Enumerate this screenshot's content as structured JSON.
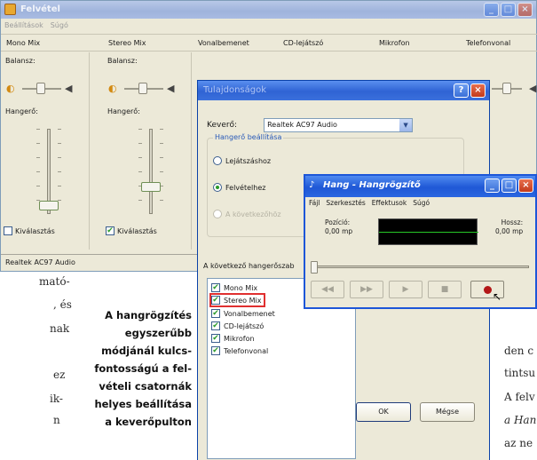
{
  "mixer": {
    "title": "Felvétel",
    "menu": [
      "Beállítások",
      "Súgó"
    ],
    "columns": [
      "Mono Mix",
      "Stereo Mix",
      "Vonalbemenet",
      "CD-lejátszó",
      "Mikrofon",
      "Telefonvonal"
    ],
    "balance_label": "Balansz:",
    "volume_label": "Hangerő:",
    "select_label": "Kiválasztás",
    "channels": [
      {
        "name": "Mono Mix",
        "selected": false,
        "volume_level": 0.06
      },
      {
        "name": "Stereo Mix",
        "selected": true,
        "volume_level": 0.3
      }
    ],
    "status": "Realtek AC97 Audio"
  },
  "properties": {
    "title": "Tulajdonságok",
    "mixer_label": "Keverő:",
    "mixer_value": "Realtek AC97 Audio",
    "group_label": "Hangerő beállítása",
    "options": [
      "Lejátszáshoz",
      "Felvételhez",
      "A következőhöz"
    ],
    "selected_option": "Felvételhez",
    "list_label": "A következő hangerőszab",
    "list_items": [
      "Mono Mix",
      "Stereo Mix",
      "Vonalbemenet",
      "CD-lejátszó",
      "Mikrofon",
      "Telefonvonal"
    ],
    "highlighted_item": "Stereo Mix",
    "ok": "OK",
    "cancel": "Mégse"
  },
  "recorder": {
    "title": "Hang - Hangrögzítő",
    "menu": [
      "Fájl",
      "Szerkesztés",
      "Effektusok",
      "Súgó"
    ],
    "position_label": "Pozíció:",
    "position_value": "0,00 mp",
    "length_label": "Hossz:",
    "length_value": "0,00 mp",
    "buttons": [
      "◀◀",
      "▶▶",
      "▶",
      "■"
    ]
  },
  "text": {
    "caption_lines": [
      "A hangrögzítés",
      "egyszerűbb",
      "módjánál kulcs-",
      "fontosságú a fel-",
      "vételi csatornák",
      "helyes beállítása",
      "a keverőpulton"
    ],
    "left_fragments": [
      "mató-",
      ", és",
      "nak",
      "ez",
      "ik-",
      "n"
    ],
    "right_fragments": [
      "den c",
      "tintsu",
      "A felv",
      "a Han",
      "az ne"
    ]
  }
}
